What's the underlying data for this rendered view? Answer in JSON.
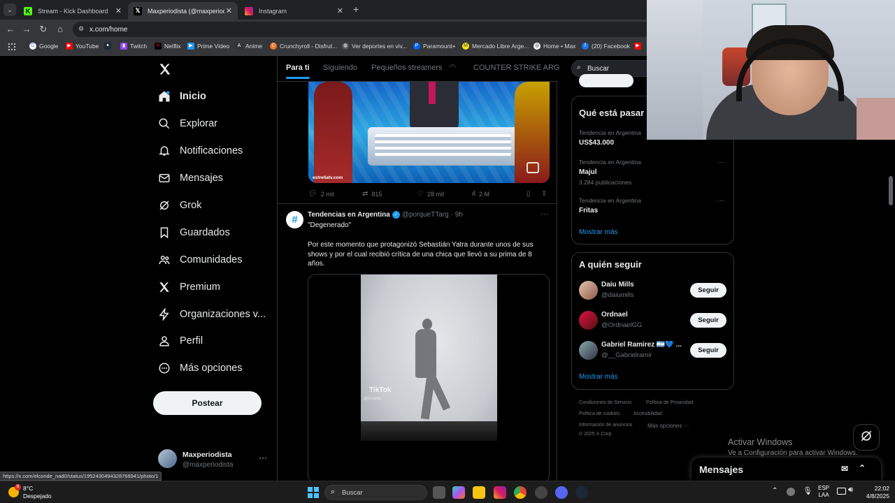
{
  "browser": {
    "tabs": [
      {
        "title": "Stream - Kick Dashboard",
        "active": false
      },
      {
        "title": "Maxperiodista (@maxperiodista",
        "active": true
      },
      {
        "title": "Instagram",
        "active": false
      }
    ],
    "url": "x.com/home",
    "bookmarks": [
      "Google",
      "YouTube",
      "Twitch",
      "Netflix",
      "Prime Video",
      "Anime",
      "Crunchyroll - Disfrut...",
      "Ver deportes en viv...",
      "Paramount+",
      "Mercado Libre Arge...",
      "Home • Max",
      "(20) Facebook"
    ],
    "status_url": "https://x.com/elconde_nad0/status/1952430494328766941/photo/1"
  },
  "sidebar": {
    "items": [
      {
        "label": "Inicio",
        "icon": "home-icon"
      },
      {
        "label": "Explorar",
        "icon": "search-icon"
      },
      {
        "label": "Notificaciones",
        "icon": "bell-icon"
      },
      {
        "label": "Mensajes",
        "icon": "mail-icon"
      },
      {
        "label": "Grok",
        "icon": "grok-icon"
      },
      {
        "label": "Guardados",
        "icon": "bookmark-icon"
      },
      {
        "label": "Comunidades",
        "icon": "people-icon"
      },
      {
        "label": "Premium",
        "icon": "x-icon"
      },
      {
        "label": "Organizaciones v...",
        "icon": "bolt-icon"
      },
      {
        "label": "Perfil",
        "icon": "person-icon"
      },
      {
        "label": "Más opciones",
        "icon": "more-circle-icon"
      }
    ],
    "post_label": "Postear",
    "account": {
      "name": "Maxperiodista",
      "handle": "@maxperiodista"
    }
  },
  "feed": {
    "tabs": [
      "Para ti",
      "Siguiendo",
      "Pequeños streamers",
      "COUNTER STRIKE ARG"
    ],
    "tweet1": {
      "media_caption": "estrellatv.com",
      "stats": {
        "replies": "2 mil",
        "reposts": "815",
        "likes": "28 mil",
        "views": "2 M"
      }
    },
    "tweet2": {
      "author": "Tendencias en Argentina",
      "handle": "@porqueTTarg",
      "time": "· 9h",
      "text_line1": "\"Degenerado\"",
      "text_body": "Por este momento que protagonizó Sebastián Yatra durante unos de sus shows y por el cual recibió crítica de una chica que llevó a su prima de 8 años.",
      "media_watermark": "TikTok",
      "media_handle": "@ni7ai05"
    }
  },
  "right": {
    "search_placeholder": "Buscar",
    "trends_title": "Qué está pasar",
    "trends": [
      {
        "meta": "Tendencia en Argentina",
        "title": "US$43.000",
        "count": ""
      },
      {
        "meta": "Tendencia en Argentina",
        "title": "Majul",
        "count": "3.284 publicaciones"
      },
      {
        "meta": "Tendencia en Argentina",
        "title": "Fritas",
        "count": ""
      }
    ],
    "show_more": "Mostrar más",
    "follow_title": "A quién seguir",
    "follow": [
      {
        "name": "Daiu Mills",
        "handle": "@daiumills",
        "button": "Seguir"
      },
      {
        "name": "Ordnael",
        "handle": "@OrdnaelGG",
        "button": "Seguir"
      },
      {
        "name": "Gabriel Ramirez 🇦🇷💙 ...",
        "handle": "@__Gabrielramir",
        "button": "Seguir"
      }
    ],
    "footer": {
      "l1": "Condiciones de Servicio",
      "l2": "Política de Privacidad",
      "l3": "Política de cookies",
      "l4": "Accesibilidad",
      "l5": "Información de anuncios",
      "l6": "Más opciones ···",
      "l7": "© 2025 X Corp."
    }
  },
  "overlay": {
    "activate_title": "Activar Windows",
    "activate_sub": "Ve a Configuración para activar Windows.",
    "messages_label": "Mensajes"
  },
  "taskbar": {
    "weather_temp": "8°C",
    "weather_desc": "Despejado",
    "weather_badge": "8",
    "search_label": "Buscar",
    "lang1": "ESP",
    "lang2": "LAA",
    "time": "22:02",
    "date": "4/8/2025"
  },
  "colors": {
    "accent": "#1d9bf0",
    "background": "#000000",
    "muted": "#71767b"
  }
}
